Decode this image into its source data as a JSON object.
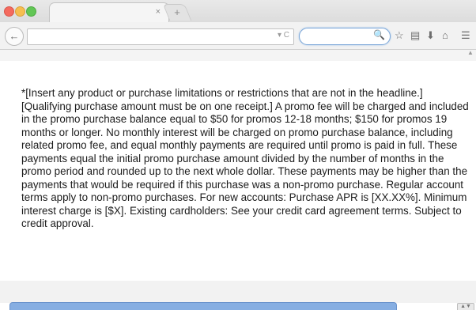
{
  "browser": {
    "tab_close_glyph": "×",
    "newtab_glyph": "+",
    "back_glyph": "←",
    "url_value": "",
    "url_icons": "▾ C",
    "search_value": "",
    "search_glyph": "🔍",
    "toolbar_glyphs": [
      "☆",
      "▤",
      "⬇",
      "⌂",
      "☰"
    ],
    "scroll_glyph": "▲"
  },
  "content": {
    "disclaimer": "*[Insert any product or purchase limitations or restrictions that are not in the headline.] [Qualifying purchase amount must be on one receipt.] A promo fee will be charged and included in the promo purchase balance equal to $50 for promos 12-18 months; $150 for promos 19 months or longer. No monthly interest will be charged on promo purchase balance, including related promo fee, and equal monthly payments are required until promo is paid in full. These payments equal the initial promo purchase amount divided by the number of months in the promo period and rounded up to the next whole dollar. These payments may be higher than the payments that would be required if this purchase was a non-promo purchase. Regular account terms apply to non-promo purchases. For new accounts: Purchase APR is [XX.XX%]. Minimum interest charge is [$X]. Existing cardholders: See your credit card agreement terms. Subject to credit approval."
  },
  "bottom": {
    "button_glyph": "▲▼"
  },
  "colors": {
    "accent_blue": "#86aee2",
    "close": "#f46a5e",
    "minimize": "#f6be4f",
    "maximize": "#62c655"
  }
}
